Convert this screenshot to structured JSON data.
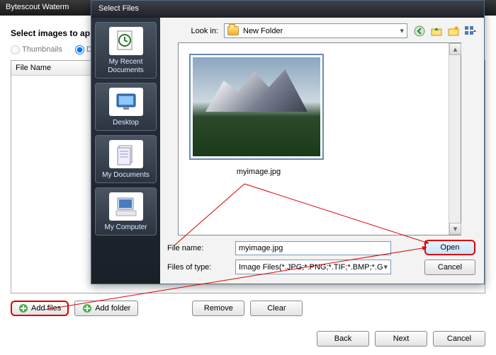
{
  "main": {
    "title": "Bytescout Waterm",
    "panel_header": "Select images to ap",
    "radio_thumbnails": "Thumbnails",
    "radio_details": "De",
    "file_name_header": "File Name",
    "add_files": "Add files",
    "add_folder": "Add folder",
    "remove": "Remove",
    "clear": "Clear",
    "back": "Back",
    "next": "Next",
    "cancel": "Cancel"
  },
  "dialog": {
    "title": "Select Files",
    "lookin_label": "Look in:",
    "lookin_value": "New Folder",
    "sidebar": [
      "My Recent Documents",
      "Desktop",
      "My Documents",
      "My Computer"
    ],
    "image_caption": "myimage.jpg",
    "filename_label": "File name:",
    "filename_value": "myimage.jpg",
    "filetype_label": "Files of type:",
    "filetype_value": "Image Files(*.JPG;*.PNG;*.TIF;*.BMP;*.GIF)",
    "open": "Open",
    "cancel": "Cancel"
  }
}
